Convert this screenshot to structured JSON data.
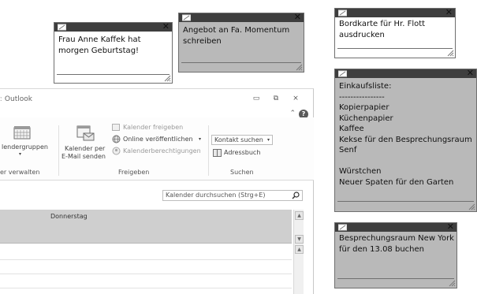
{
  "outlook": {
    "title": "Outlook",
    "window_buttons": {
      "minimize": "▭",
      "restore": "⧉",
      "close": "⨯"
    },
    "collapse_icon": "⌃",
    "help_icon": "?",
    "ribbon": {
      "groups": [
        {
          "label": "er verwalten",
          "items": [
            "lendergruppen"
          ]
        },
        {
          "label": "Freigeben",
          "items": [
            "Kalender per",
            "E-Mail senden",
            "Kalender freigeben",
            "Online veröffentlichen",
            "Kalenderberechtigungen"
          ]
        },
        {
          "label": "Suchen",
          "items": [
            "Kontakt suchen",
            "Adressbuch"
          ]
        }
      ],
      "contact_search_arrow": "▾",
      "online_publish_arrow": "▾"
    },
    "calendar_search_placeholder": "Kalender durchsuchen (Strg+E)",
    "day_header": "Donnerstag",
    "scroll_up": "▲",
    "scroll_down": "▼"
  },
  "notes": [
    {
      "id": "birthday",
      "color": "white",
      "text": "Frau Anne Kaffek hat\nmorgen Geburtstag!"
    },
    {
      "id": "offer",
      "color": "grey",
      "text": "Angebot an Fa. Momentum\nschreiben"
    },
    {
      "id": "boarding",
      "color": "white",
      "text": "Bordkarte für Hr. Flott\nausdrucken"
    },
    {
      "id": "shopping",
      "color": "grey",
      "text": "Einkaufsliste:\n----------------\nKopierpapier\nKüchenpapier\nKaffee\nKekse für den Besprechungsraum\nSenf\n\nWürstchen\nNeuer Spaten für den Garten"
    },
    {
      "id": "meeting",
      "color": "grey",
      "text": "Besprechungsraum New York\nfür den 13.08 buchen"
    }
  ],
  "note_close_glyph": "✕",
  "colors": {
    "note_bar": "#3e3e3e",
    "note_grey": "#b9b9b9",
    "note_white": "#ffffff",
    "calendar_header": "#cfcfcf"
  },
  "icons": [
    "note-pin-icon",
    "close-icon",
    "resize-grip-icon",
    "search-icon",
    "calendar-grid-icon",
    "address-book-icon",
    "help-icon"
  ]
}
